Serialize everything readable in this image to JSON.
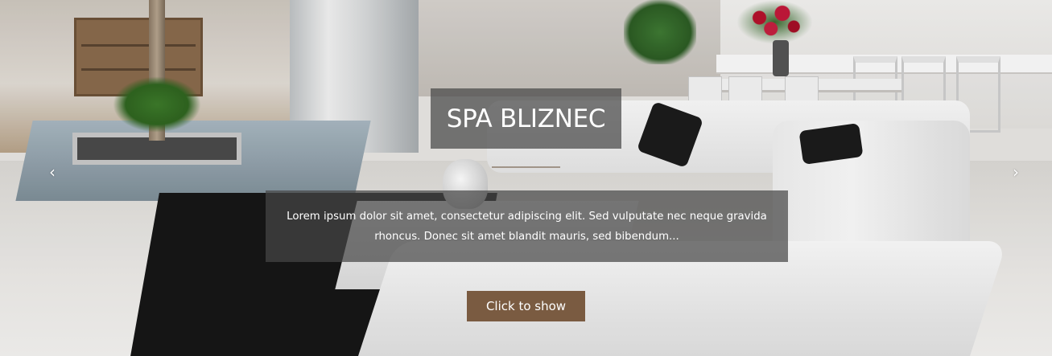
{
  "slider": {
    "title": "SPA BLIZNEC",
    "description": "Lorem ipsum dolor sit amet, consectetur adipiscing elit. Sed vulputate nec neque gravida rhoncus. Donec sit amet blandit mauris, sed bibendum...",
    "cta_label": "Click to show",
    "prev_arrow": "‹",
    "next_arrow": "›"
  },
  "colors": {
    "caption_bg": "#464646",
    "button_bg": "#7a5b41",
    "text": "#ffffff"
  },
  "icons": {
    "prev": "chevron-left-icon",
    "next": "chevron-right-icon"
  }
}
